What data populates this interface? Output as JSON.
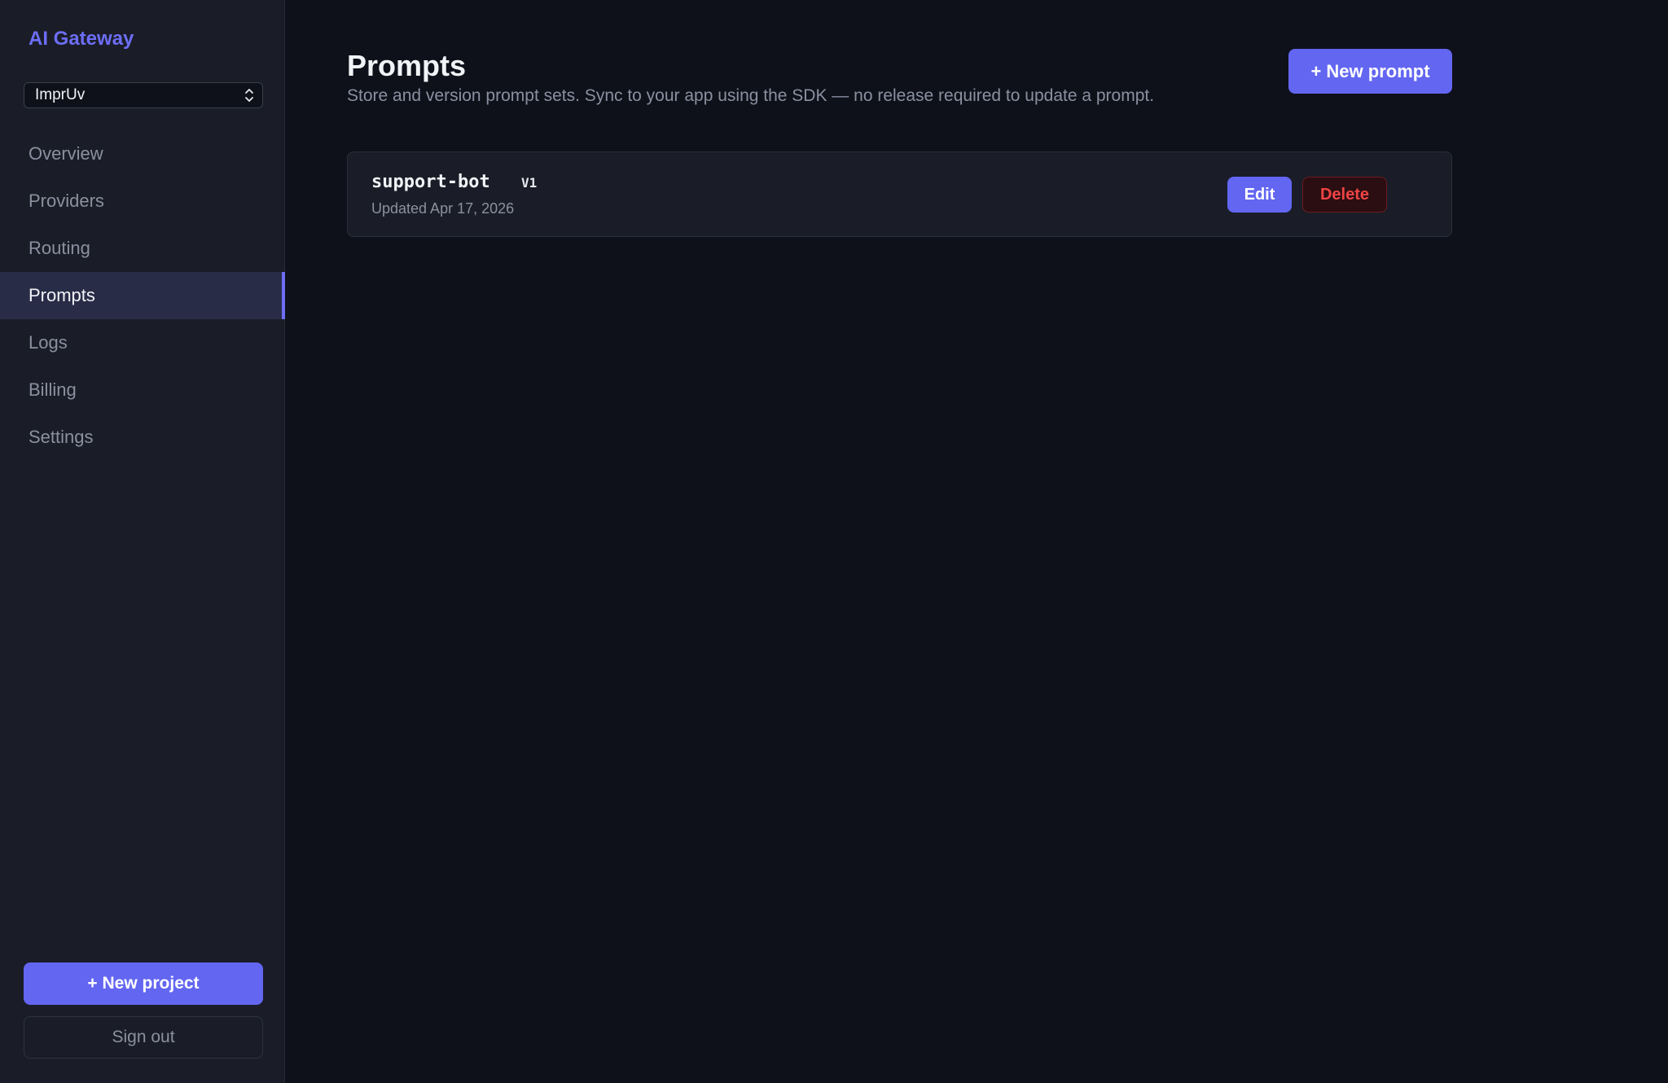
{
  "sidebar": {
    "brand": "AI Gateway",
    "project_select": {
      "value": "ImprUv"
    },
    "items": [
      {
        "label": "Overview",
        "active": false
      },
      {
        "label": "Providers",
        "active": false
      },
      {
        "label": "Routing",
        "active": false
      },
      {
        "label": "Prompts",
        "active": true
      },
      {
        "label": "Logs",
        "active": false
      },
      {
        "label": "Billing",
        "active": false
      },
      {
        "label": "Settings",
        "active": false
      }
    ],
    "new_project_label": "+ New project",
    "sign_out_label": "Sign out"
  },
  "main": {
    "title": "Prompts",
    "subtitle": "Store and version prompt sets. Sync to your app using the SDK — no release required to update a prompt.",
    "new_prompt_label": "+ New prompt",
    "prompts": [
      {
        "name": "support-bot",
        "version": "V1",
        "updated": "Updated Apr 17, 2026",
        "edit_label": "Edit",
        "delete_label": "Delete"
      }
    ]
  },
  "colors": {
    "accent": "#6366f1",
    "brand": "#6d6df5",
    "danger": "#ef4444",
    "background": "#0e111a",
    "sidebar": "#1a1d27"
  }
}
